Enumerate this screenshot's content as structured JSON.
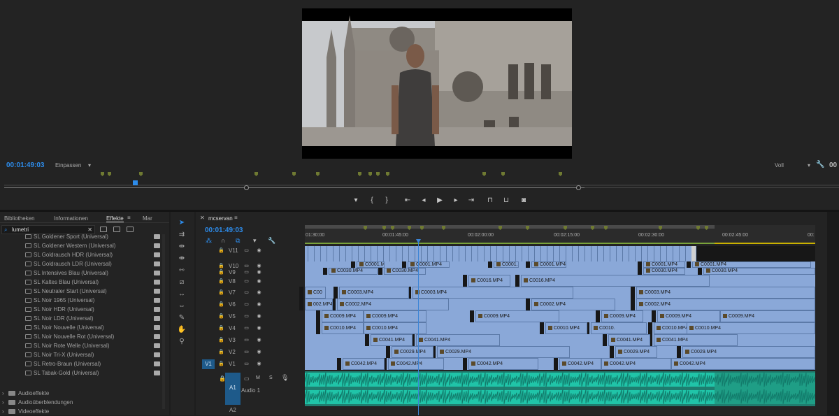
{
  "program_monitor": {
    "timecode": "00:01:49:03",
    "fit_label": "Einpassen",
    "quality_label": "Voll",
    "timecode_right": "00"
  },
  "controls": [
    {
      "name": "marker-button",
      "glyph": "▾"
    },
    {
      "name": "mark-in-button",
      "glyph": "{"
    },
    {
      "name": "mark-out-button",
      "glyph": "}"
    },
    {
      "name": "go-to-in-button",
      "glyph": "⇤"
    },
    {
      "name": "step-back-button",
      "glyph": "◂"
    },
    {
      "name": "play-button",
      "glyph": "▶"
    },
    {
      "name": "step-forward-button",
      "glyph": "▸"
    },
    {
      "name": "go-to-out-button",
      "glyph": "⇥"
    },
    {
      "name": "insert-button",
      "glyph": "⊓"
    },
    {
      "name": "overwrite-button",
      "glyph": "⊔"
    },
    {
      "name": "export-frame-button",
      "glyph": "◙"
    }
  ],
  "left_panel": {
    "tabs": [
      "Bibliotheken",
      "Informationen",
      "Effekte",
      "Mar"
    ],
    "active_tab": "Effekte",
    "search_value": "lumetri",
    "effects": [
      "SL Goldener Sport (Universal)",
      "SL Goldener Western (Universal)",
      "SL Goldrausch HDR (Universal)",
      "SL Goldrausch LDR (Universal)",
      "SL Intensives Blau (Universal)",
      "SL Kaltes Blau (Universal)",
      "SL Neutraler Start (Universal)",
      "SL Noir 1965 (Universal)",
      "SL Noir HDR (Universal)",
      "SL Noir LDR (Universal)",
      "SL Noir Nouvelle (Universal)",
      "SL Noir Nouvelle Rot (Universal)",
      "SL Noir Rote Welle (Universal)",
      "SL Noir Tri-X (Universal)",
      "SL Retro-Braun (Universal)",
      "SL Tabak-Gold (Universal)"
    ],
    "folders": [
      "Audioeffekte",
      "Audioüberblendungen",
      "Videoeffekte"
    ]
  },
  "tools": [
    {
      "name": "selection-tool",
      "glyph": "➤",
      "active": true
    },
    {
      "name": "track-select-tool",
      "glyph": "⇉"
    },
    {
      "name": "ripple-edit-tool",
      "glyph": "⇹"
    },
    {
      "name": "rolling-edit-tool",
      "glyph": "⇼"
    },
    {
      "name": "rate-stretch-tool",
      "glyph": "⇿"
    },
    {
      "name": "razor-tool",
      "glyph": "⧄"
    },
    {
      "name": "slip-tool",
      "glyph": "↔"
    },
    {
      "name": "slide-tool",
      "glyph": "⇔"
    },
    {
      "name": "pen-tool",
      "glyph": "✎"
    },
    {
      "name": "hand-tool",
      "glyph": "✋"
    },
    {
      "name": "zoom-tool",
      "glyph": "⚲"
    }
  ],
  "timeline": {
    "sequence_name": "mcservan",
    "timecode": "00:01:49:03",
    "ruler_labels": [
      "01:30:00",
      "00:01:45:00",
      "00:02:00:00",
      "00:02:15:00",
      "00:02:30:00",
      "00:02:45:00",
      "00:"
    ],
    "video_tracks": [
      "V11",
      "V10",
      "V9",
      "V8",
      "V7",
      "V6",
      "V5",
      "V4",
      "V3",
      "V2",
      "V1"
    ],
    "source_patch": "V1",
    "audio_track": {
      "patch": "A1",
      "name": "A1",
      "label": "Audio 1",
      "m": "M",
      "s": "S"
    },
    "audio_track2": "A2",
    "track_rows": [
      {
        "track": "V10",
        "clips": [
          {
            "l": "C0001.MP4"
          },
          {
            "l": "C0001.MP4"
          },
          {
            "l": "C0001."
          },
          {
            "l": "C0001.MP4"
          },
          {
            "l": "C0001.MP4"
          },
          {
            "l": "C0001.MP4"
          }
        ]
      },
      {
        "track": "V9",
        "clips": [
          {
            "l": "C0030.MP4"
          },
          {
            "l": "C0030.MP4"
          },
          {
            "l": "C0030.MP4"
          },
          {
            "l": "C0030.MP4"
          }
        ]
      },
      {
        "track": "V8",
        "clips": [
          {
            "l": "C0016.MP4"
          },
          {
            "l": "C0016.MP4"
          }
        ]
      },
      {
        "track": "V7",
        "clips": [
          {
            "l": "C00"
          },
          {
            "l": "C0003.MP4"
          },
          {
            "l": "C0003.MP4"
          },
          {
            "l": "C0003.MP4"
          }
        ]
      },
      {
        "track": "V6",
        "clips": [
          {
            "l": "002.MP4"
          },
          {
            "l": "C0002.MP4"
          },
          {
            "l": "C0002.MP4"
          },
          {
            "l": "C0002.MP4"
          }
        ]
      },
      {
        "track": "V5",
        "clips": [
          {
            "l": "C0009.MP4"
          },
          {
            "l": "C0009.MP4"
          },
          {
            "l": "C0009.MP4"
          },
          {
            "l": "C0009.MP4"
          },
          {
            "l": "C0009.MP4"
          },
          {
            "l": "C0009.MP4"
          }
        ]
      },
      {
        "track": "V4",
        "clips": [
          {
            "l": "C0010.MP4"
          },
          {
            "l": "C0010.MP4"
          },
          {
            "l": "C0010.MP4"
          },
          {
            "l": "C0010."
          },
          {
            "l": "C0010.MP4"
          },
          {
            "l": "C0010.MP4"
          }
        ]
      },
      {
        "track": "V3",
        "clips": [
          {
            "l": "C0041.MP4"
          },
          {
            "l": "C0041.MP4"
          },
          {
            "l": "C0041.MP4"
          },
          {
            "l": "C0041.MP4"
          }
        ]
      },
      {
        "track": "V2",
        "clips": [
          {
            "l": "C0029.MP4"
          },
          {
            "l": "C0029.MP4"
          },
          {
            "l": "C0029.MP4"
          },
          {
            "l": "C0029.MP4"
          }
        ]
      },
      {
        "track": "V1",
        "clips": [
          {
            "l": "C0042.MP4"
          },
          {
            "l": "C0042.MP4"
          },
          {
            "l": "C0042.MP4"
          },
          {
            "l": "C0042.MP4"
          },
          {
            "l": "C0042.MP4"
          },
          {
            "l": "C0042.MP4"
          }
        ]
      }
    ]
  },
  "colors": {
    "accent": "#2d8ceb",
    "clip": "#8aa8d8",
    "audio": "#20c4a8",
    "marker": "#6f7a32"
  }
}
